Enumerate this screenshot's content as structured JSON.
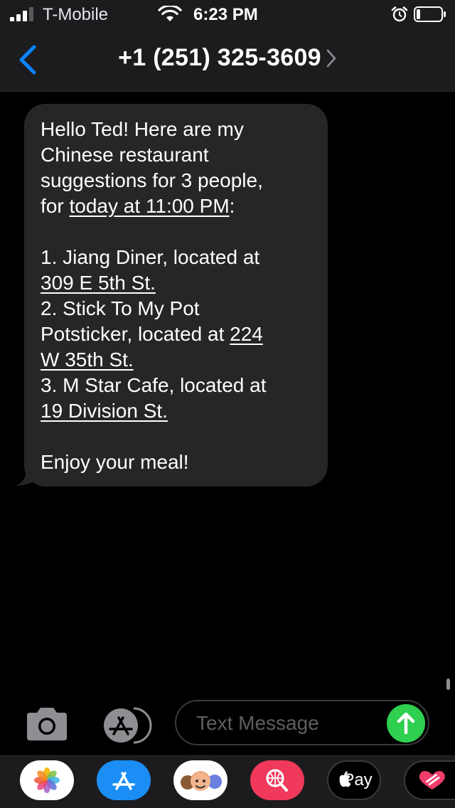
{
  "status_bar": {
    "carrier": "T-Mobile",
    "time": "6:23 PM",
    "signal_bars": 3,
    "battery_level": 0.15
  },
  "nav": {
    "contact": "+1 (251) 325-3609"
  },
  "message": {
    "intro_1": "Hello Ted! Here are my",
    "intro_2": "Chinese restaurant",
    "intro_3": "suggestions for 3 people,",
    "intro_4_prefix": "for ",
    "intro_4_link": "today at 11:00 PM",
    "intro_4_suffix": ":",
    "item1_line1": "1. Jiang Diner, located at",
    "item1_link": "309 E 5th St.",
    "item2_line1": "2. Stick To My Pot",
    "item2_line2_prefix": "Potsticker, located at ",
    "item2_link_a": "224",
    "item2_link_b": "W 35th St.",
    "item3_line1": "3. M Star Cafe, located at",
    "item3_link": "19 Division St.",
    "closing": "Enjoy your meal!"
  },
  "input": {
    "placeholder": "Text Message"
  },
  "app_drawer": {
    "apps": [
      "photos-icon",
      "app-store-icon",
      "memoji-icon",
      "web-search-icon",
      "apple-pay-icon",
      "digital-touch-icon"
    ],
    "pay_label": "Pay"
  },
  "colors": {
    "accent_blue": "#0a84ff",
    "send_green": "#2fcf4f",
    "bubble_gray": "#262629",
    "bar_bg": "#1c1c1e"
  }
}
